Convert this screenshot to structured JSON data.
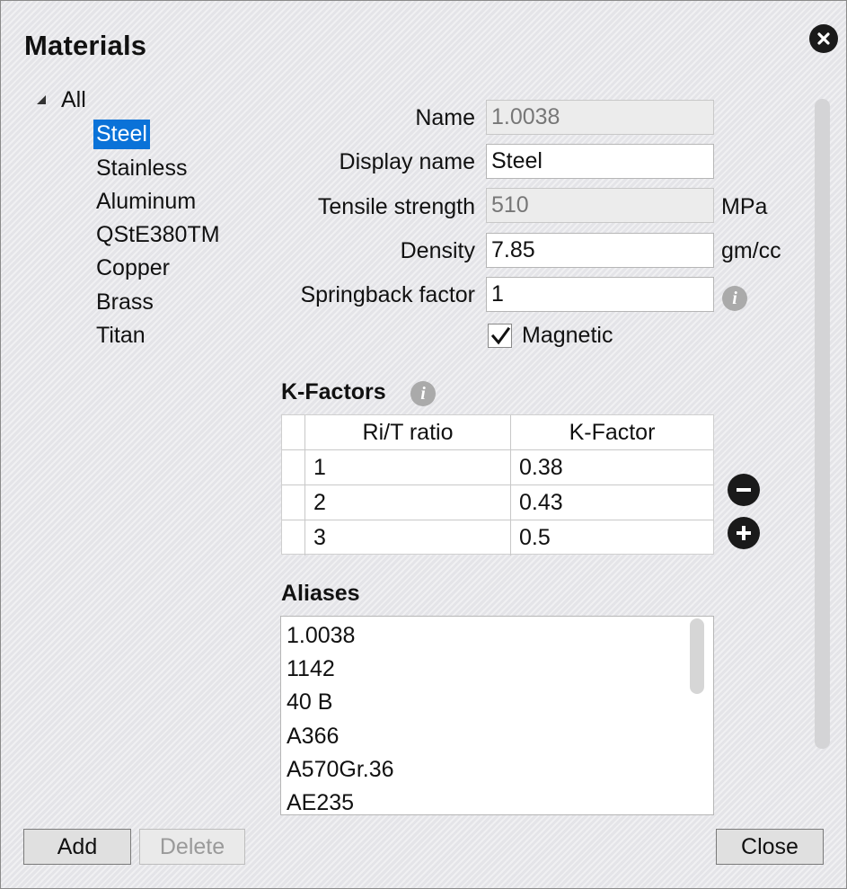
{
  "dialog": {
    "title": "Materials",
    "close_icon": "close-icon"
  },
  "tree": {
    "root": "All",
    "items": [
      "Steel",
      "Stainless",
      "Aluminum",
      "QStE380TM",
      "Copper",
      "Brass",
      "Titan"
    ],
    "selected": "Steel"
  },
  "form": {
    "name": {
      "label": "Name",
      "value": "1.0038"
    },
    "display_name": {
      "label": "Display name",
      "value": "Steel"
    },
    "tensile_strength": {
      "label": "Tensile strength",
      "value": "510",
      "unit": "MPa"
    },
    "density": {
      "label": "Density",
      "value": "7.85",
      "unit": "gm/cc"
    },
    "springback_factor": {
      "label": "Springback factor",
      "value": "1"
    },
    "magnetic": {
      "label": "Magnetic",
      "checked": true
    }
  },
  "kfactors": {
    "title": "K-Factors",
    "columns": [
      "Ri/T ratio",
      "K-Factor"
    ],
    "rows": [
      {
        "ratio": "1",
        "kfactor": "0.38"
      },
      {
        "ratio": "2",
        "kfactor": "0.43"
      },
      {
        "ratio": "3",
        "kfactor": "0.5"
      }
    ]
  },
  "aliases": {
    "title": "Aliases",
    "items": [
      "1.0038",
      "1142",
      "40 B",
      "A366",
      "A570Gr.36",
      "AE235"
    ]
  },
  "buttons": {
    "add": "Add",
    "delete": "Delete",
    "close": "Close"
  },
  "colors": {
    "selection": "#0a72d8",
    "icon_dark": "#1a1a1a",
    "info_gray": "#aaaaaa"
  }
}
